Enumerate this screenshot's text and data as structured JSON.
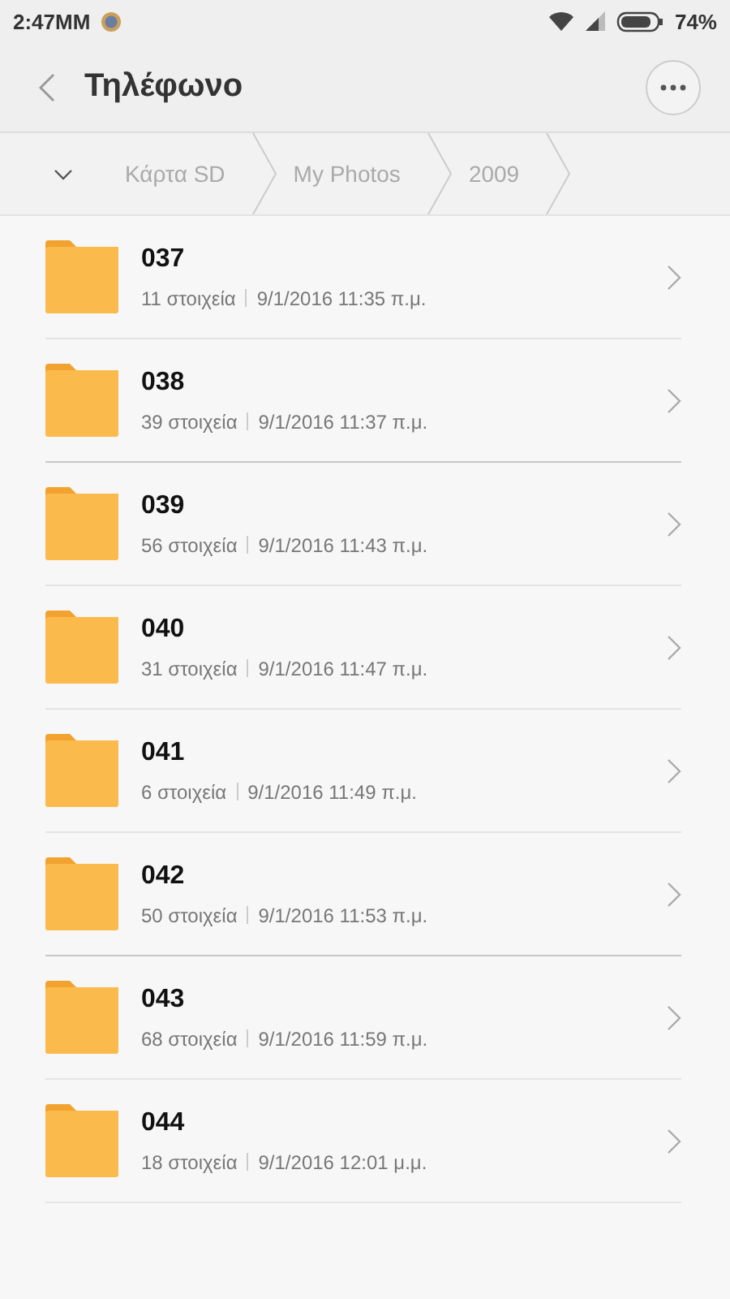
{
  "status_bar": {
    "time": "2:47MM",
    "battery": "74%"
  },
  "toolbar": {
    "title": "Τηλέφωνο"
  },
  "breadcrumbs": [
    {
      "label": "Κάρτα SD"
    },
    {
      "label": "My Photos"
    },
    {
      "label": "2009"
    }
  ],
  "folders": [
    {
      "name": "037",
      "count": "11 στοιχεία",
      "date": "9/1/2016 11:35 π.μ."
    },
    {
      "name": "038",
      "count": "39 στοιχεία",
      "date": "9/1/2016 11:37 π.μ."
    },
    {
      "name": "039",
      "count": "56 στοιχεία",
      "date": "9/1/2016 11:43 π.μ."
    },
    {
      "name": "040",
      "count": "31 στοιχεία",
      "date": "9/1/2016 11:47 π.μ."
    },
    {
      "name": "041",
      "count": "6 στοιχεία",
      "date": "9/1/2016 11:49 π.μ."
    },
    {
      "name": "042",
      "count": "50 στοιχεία",
      "date": "9/1/2016 11:53 π.μ."
    },
    {
      "name": "043",
      "count": "68 στοιχεία",
      "date": "9/1/2016 11:59 π.μ."
    },
    {
      "name": "044",
      "count": "18 στοιχεία",
      "date": "9/1/2016 12:01 μ.μ."
    }
  ]
}
